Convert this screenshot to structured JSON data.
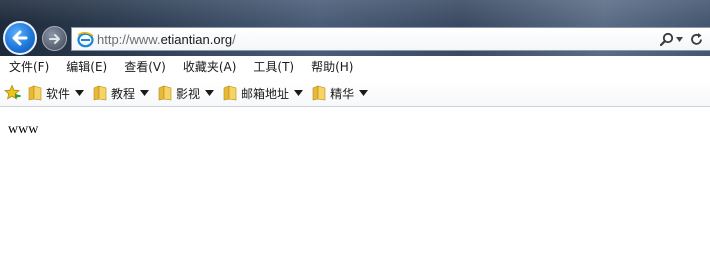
{
  "navigation": {
    "back_icon": "back-arrow-icon",
    "forward_icon": "forward-arrow-icon"
  },
  "address_bar": {
    "url_prefix": "http://www.",
    "url_domain": "etiantian.org",
    "url_suffix": "/",
    "page_icon": "ie-page-icon",
    "search_icon": "search-icon",
    "refresh_icon": "refresh-icon"
  },
  "menu": {
    "items": [
      {
        "label": "文件(F)"
      },
      {
        "label": "编辑(E)"
      },
      {
        "label": "查看(V)"
      },
      {
        "label": "收藏夹(A)"
      },
      {
        "label": "工具(T)"
      },
      {
        "label": "帮助(H)"
      }
    ]
  },
  "favorites": {
    "star_icon": "add-favorites-icon",
    "folders": [
      {
        "label": "软件"
      },
      {
        "label": "教程"
      },
      {
        "label": "影视"
      },
      {
        "label": "邮箱地址"
      },
      {
        "label": "精华"
      }
    ]
  },
  "content": {
    "text": "www"
  },
  "colors": {
    "back_button": "#1f78d8",
    "folder": "#e8b938",
    "star": "#f0c419"
  }
}
